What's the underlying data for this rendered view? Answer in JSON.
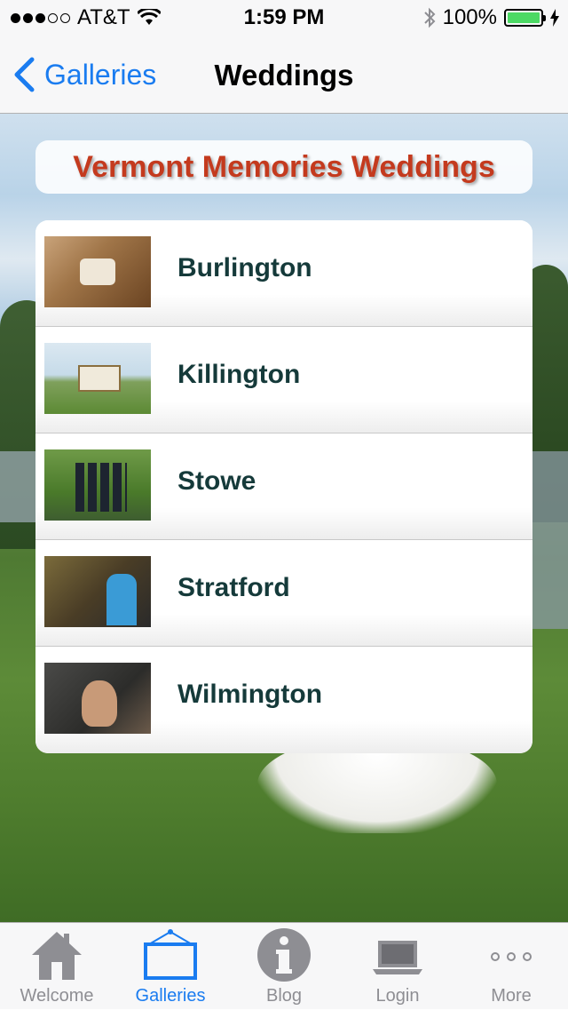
{
  "status_bar": {
    "carrier": "AT&T",
    "time": "1:59 PM",
    "battery": "100%",
    "icons": [
      "signal-dots-icon",
      "wifi-icon",
      "bluetooth-icon",
      "battery-icon",
      "charging-bolt-icon"
    ]
  },
  "nav": {
    "back_label": "Galleries",
    "title": "Weddings"
  },
  "banner": {
    "title": "Vermont Memories Weddings",
    "color": "#c43a1e"
  },
  "galleries": [
    {
      "label": "Burlington"
    },
    {
      "label": "Killington"
    },
    {
      "label": "Stowe"
    },
    {
      "label": "Stratford"
    },
    {
      "label": "Wilmington"
    }
  ],
  "tabbar": {
    "tabs": [
      {
        "label": "Welcome",
        "icon": "house-icon"
      },
      {
        "label": "Galleries",
        "icon": "picture-frame-icon",
        "active": true
      },
      {
        "label": "Blog",
        "icon": "info-icon"
      },
      {
        "label": "Login",
        "icon": "laptop-icon"
      },
      {
        "label": "More",
        "icon": "more-dots-icon"
      }
    ],
    "active_color": "#1a7cf0",
    "inactive_color": "#8e8e93"
  }
}
